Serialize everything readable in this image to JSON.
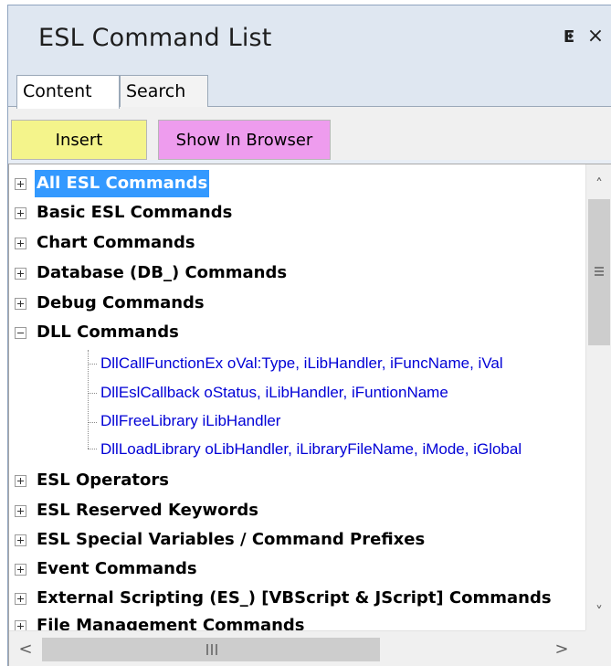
{
  "panel": {
    "title": "ESL Command List",
    "pin_glyph": "ⵟ",
    "close_glyph": "×"
  },
  "tabs": [
    {
      "label": "Content",
      "active": true
    },
    {
      "label": "Search",
      "active": false
    }
  ],
  "toolbar": {
    "insert_label": "Insert",
    "browser_label": "Show In Browser",
    "insert_color": "#f4f48b",
    "browser_color": "#ee9cee"
  },
  "tree": {
    "selection_color": "#3399ff",
    "link_color": "#0000d6",
    "items": [
      {
        "label": "All ESL Commands",
        "expanded": false,
        "selected": true
      },
      {
        "label": "Basic ESL Commands",
        "expanded": false
      },
      {
        "label": "Chart Commands",
        "expanded": false
      },
      {
        "label": "Database (DB_) Commands",
        "expanded": false
      },
      {
        "label": "Debug Commands",
        "expanded": false
      },
      {
        "label": "DLL Commands",
        "expanded": true
      },
      {
        "label": "ESL Operators",
        "expanded": false
      },
      {
        "label": "ESL Reserved Keywords",
        "expanded": false
      },
      {
        "label": "ESL Special Variables / Command Prefixes",
        "expanded": false
      },
      {
        "label": "Event Commands",
        "expanded": false
      },
      {
        "label": "External Scripting (ES_)  [VBScript & JScript] Commands",
        "expanded": false
      },
      {
        "label": "File Management Commands",
        "expanded": false
      }
    ],
    "dll_children": [
      "DllCallFunctionEx oVal:Type, iLibHandler, iFuncName, iVal",
      "DllEslCallback oStatus, iLibHandler, iFuntionName",
      "DllFreeLibrary iLibHandler",
      "DllLoadLibrary oLibHandler, iLibraryFileName, iMode, iGlobal"
    ]
  },
  "scrollbars": {
    "up_glyph": "˄",
    "down_glyph": "˅",
    "left_glyph": "<",
    "right_glyph": ">"
  }
}
